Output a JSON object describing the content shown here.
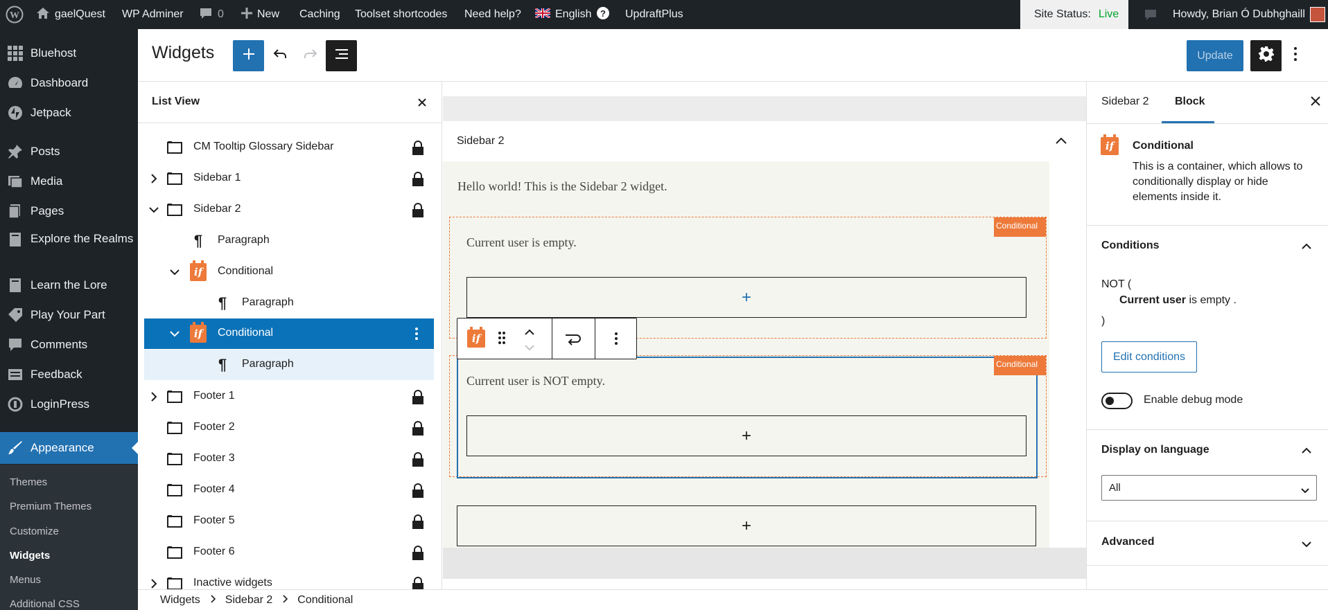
{
  "adminbar": {
    "site_name": "gaelQuest",
    "wp_adminer": "WP Adminer",
    "comments_count": "0",
    "new_label": "New",
    "caching": "Caching",
    "toolset": "Toolset shortcodes",
    "need_help": "Need help?",
    "language": "English",
    "updraft": "UpdraftPlus",
    "site_status_label": "Site Status:",
    "site_status_value": "Live",
    "howdy": "Howdy, Brian Ó Dubhghaill"
  },
  "admin_menu": {
    "items": [
      {
        "label": "Bluehost",
        "icon": "grid-icon"
      },
      {
        "label": "Dashboard",
        "icon": "dashboard-icon"
      },
      {
        "label": "Jetpack",
        "icon": "jetpack-icon"
      },
      {
        "label": "Posts",
        "icon": "pin-icon"
      },
      {
        "label": "Media",
        "icon": "media-icon"
      },
      {
        "label": "Pages",
        "icon": "pages-icon"
      },
      {
        "label": "Explore the Realms",
        "icon": "book-icon"
      },
      {
        "label": "Learn the Lore",
        "icon": "book-icon"
      },
      {
        "label": "Play Your Part",
        "icon": "tag-icon"
      },
      {
        "label": "Comments",
        "icon": "comment-icon"
      },
      {
        "label": "Feedback",
        "icon": "feedback-icon"
      },
      {
        "label": "LoginPress",
        "icon": "loginpress-icon"
      },
      {
        "label": "Appearance",
        "icon": "brush-icon"
      }
    ],
    "submenu": [
      "Themes",
      "Premium Themes",
      "Customize",
      "Widgets",
      "Menus",
      "Additional CSS"
    ]
  },
  "header": {
    "title": "Widgets",
    "update_label": "Update"
  },
  "list_view": {
    "title": "List View",
    "rows": [
      {
        "label": "CM Tooltip Glossary Sidebar"
      },
      {
        "label": "Sidebar 1"
      },
      {
        "label": "Sidebar 2"
      },
      {
        "label": "Paragraph"
      },
      {
        "label": "Conditional"
      },
      {
        "label": "Paragraph"
      },
      {
        "label": "Conditional"
      },
      {
        "label": "Paragraph"
      },
      {
        "label": "Footer 1"
      },
      {
        "label": "Footer 2"
      },
      {
        "label": "Footer 3"
      },
      {
        "label": "Footer 4"
      },
      {
        "label": "Footer 5"
      },
      {
        "label": "Footer 6"
      },
      {
        "label": "Inactive widgets"
      }
    ]
  },
  "canvas": {
    "area_title": "Sidebar 2",
    "paragraph": "Hello world! This is the Sidebar 2 widget.",
    "cond1_text": "Current user is empty.",
    "cond2_text": "Current user is NOT empty.",
    "cond_tag": "Conditional",
    "plus": "+"
  },
  "inspector": {
    "tab_sidebar": "Sidebar 2",
    "tab_block": "Block",
    "block_name": "Conditional",
    "block_desc": "This is a container, which allows to conditionally display or hide elements inside it.",
    "conditions_title": "Conditions",
    "not_open": "NOT (",
    "cond_bold": "Current user",
    "cond_rest": " is empty .",
    "close_paren": ")",
    "edit_conditions": "Edit conditions",
    "debug_label": "Enable debug mode",
    "debug_enabled": false,
    "language_title": "Display on language",
    "language_value": "All",
    "advanced_title": "Advanced"
  },
  "breadcrumb": [
    "Widgets",
    "Sidebar 2",
    "Conditional"
  ],
  "colors": {
    "accent": "#2271b1",
    "conditional": "#ed7a3a",
    "selected_row": "#0a72b8",
    "admin_bg": "#1d2327"
  }
}
